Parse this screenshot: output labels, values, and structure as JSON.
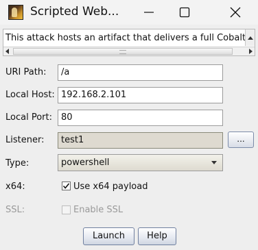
{
  "window": {
    "title": "Scripted Web...",
    "icon": "app-icon",
    "buttons": [
      "minimize-icon",
      "maximize-icon",
      "close-icon"
    ]
  },
  "description": {
    "text": "This attack hosts an artifact that delivers a full Cobalt St"
  },
  "form": {
    "uri_path": {
      "label": "URI Path:",
      "value": "/a"
    },
    "local_host": {
      "label": "Local Host:",
      "value": "192.168.2.101"
    },
    "local_port": {
      "label": "Local Port:",
      "value": "80"
    },
    "listener": {
      "label": "Listener:",
      "value": "test1",
      "button_label": "..."
    },
    "type": {
      "label": "Type:",
      "value": "powershell"
    },
    "x64": {
      "label": "x64:",
      "checkbox_label": "Use x64 payload",
      "checked": true
    },
    "ssl": {
      "label": "SSL:",
      "checkbox_label": "Enable SSL",
      "checked": false,
      "enabled": false
    }
  },
  "actions": {
    "launch_label": "Launch",
    "help_label": "Help"
  }
}
